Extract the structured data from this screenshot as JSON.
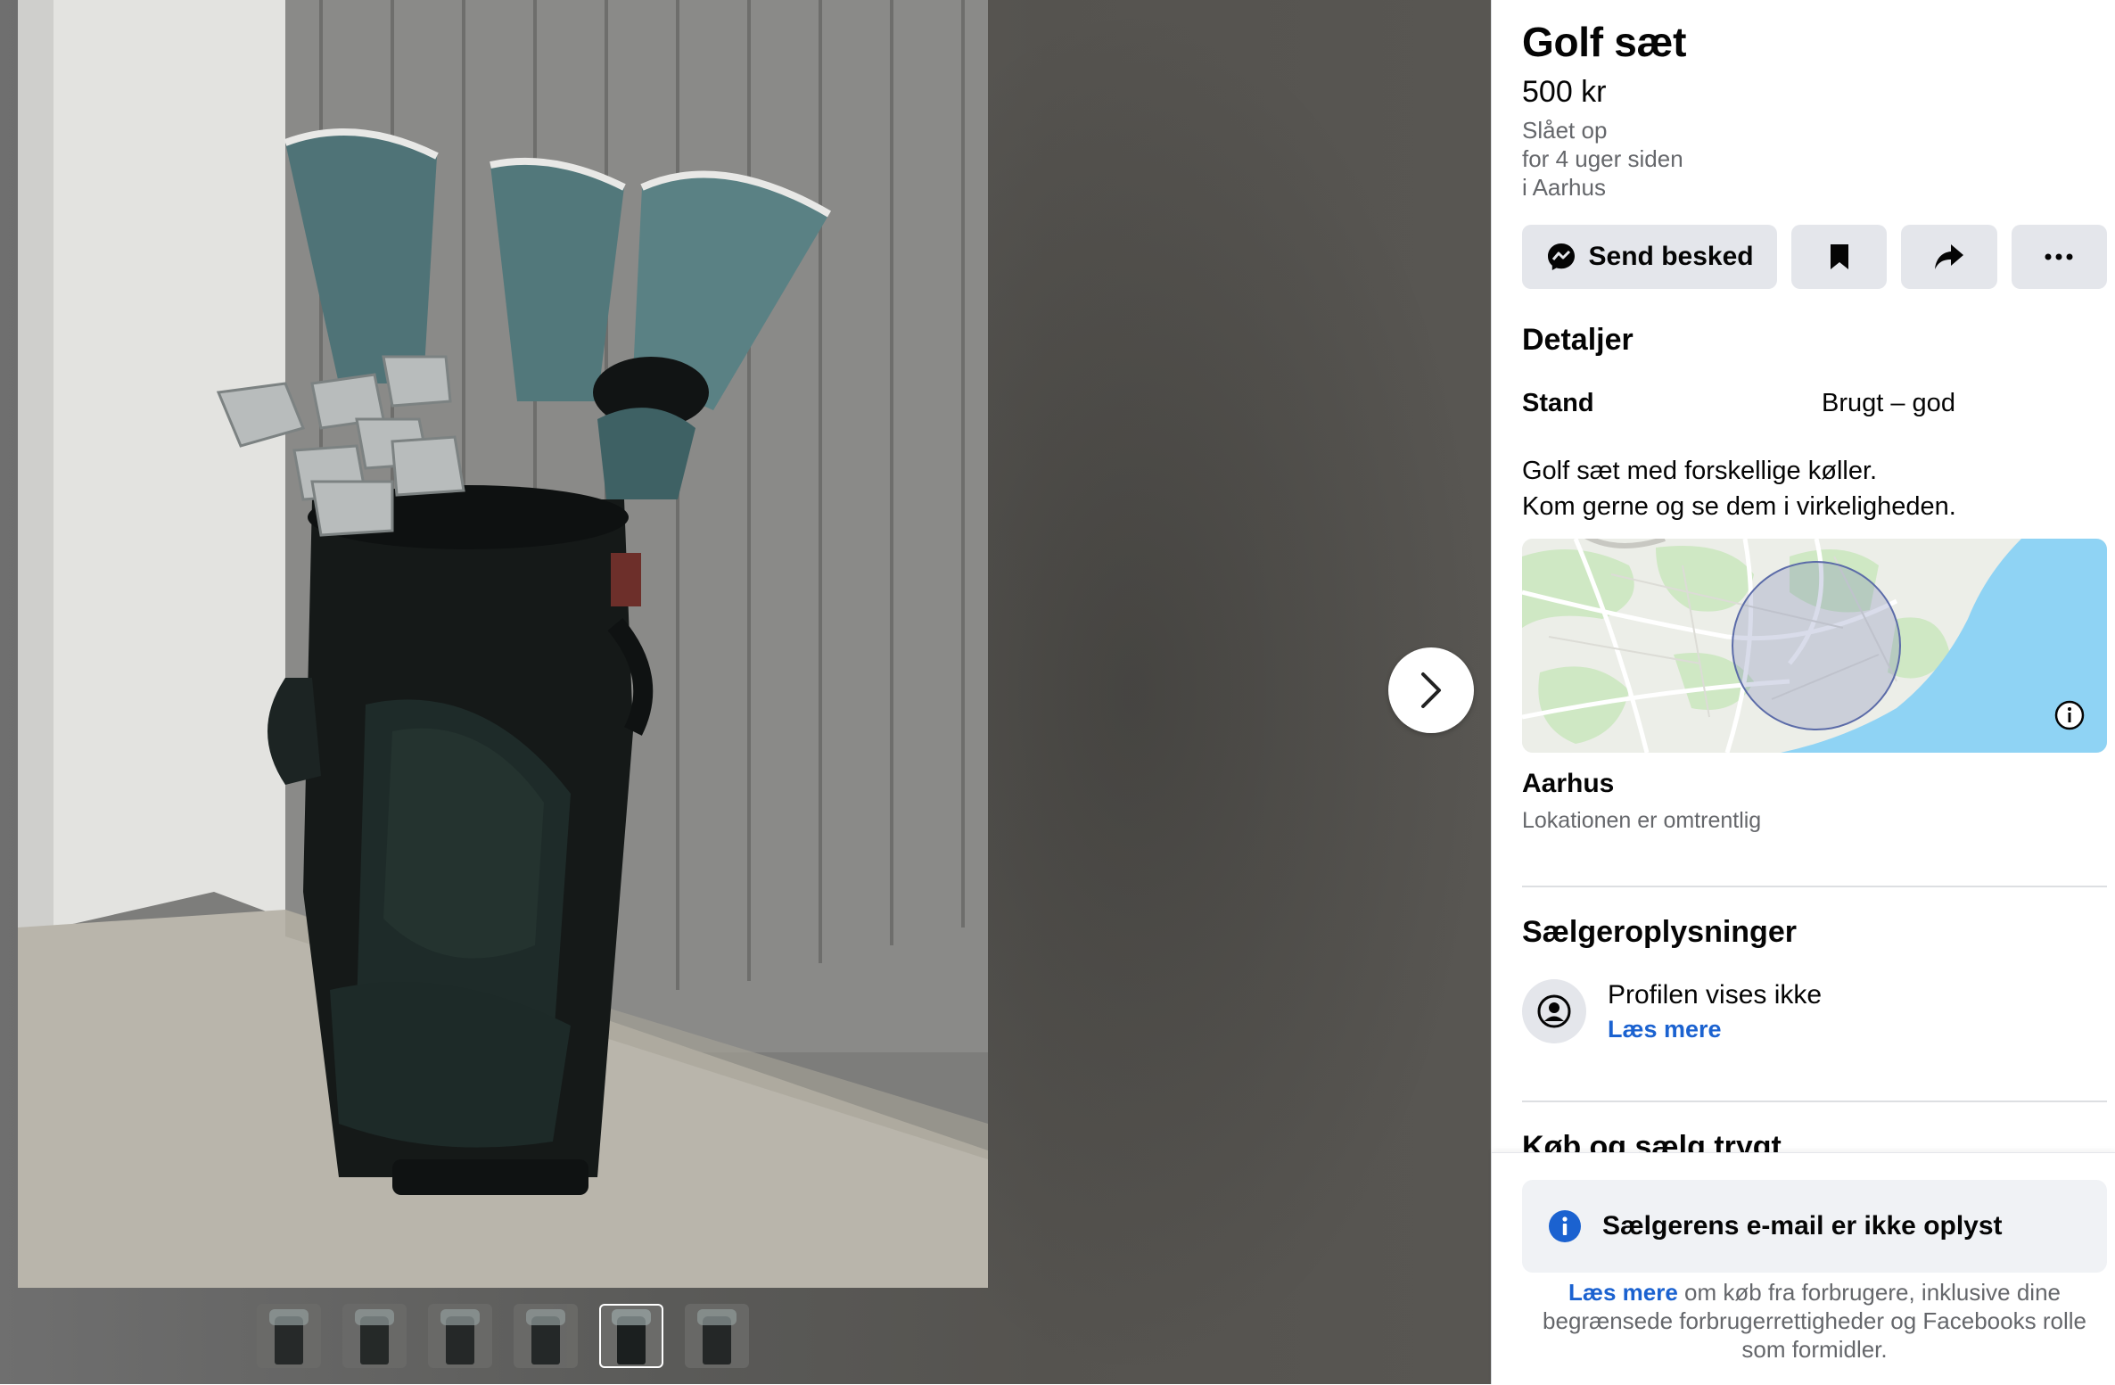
{
  "listing": {
    "title": "Golf sæt",
    "price": "500 kr",
    "posted_line1": "Slået op",
    "posted_line2": "for 4 uger siden",
    "posted_line3": "i Aarhus"
  },
  "actions": {
    "send_label": "Send besked",
    "icons": [
      "messenger-icon",
      "bookmark-icon",
      "share-icon",
      "more-icon"
    ]
  },
  "details": {
    "heading": "Detaljer",
    "stand_label": "Stand",
    "stand_value": "Brugt – god",
    "description_line1": "Golf sæt med forskellige køller.",
    "description_line2": "Kom gerne og se dem i virkeligheden."
  },
  "location": {
    "name": "Aarhus",
    "note": "Lokationen er omtrentlig"
  },
  "seller": {
    "heading": "Sælgeroplysninger",
    "profile_text": "Profilen vises ikke",
    "read_more": "Læs mere"
  },
  "trust": {
    "heading": "Køb og sælg trygt"
  },
  "notice": {
    "text": "Sælgerens e-mail er ikke oplyst",
    "read_more": "Læs mere",
    "footer": " om køb fra forbrugere, inklusive dine begrænsede forbrugerrettigheder og Facebooks rolle som formidler."
  },
  "gallery": {
    "thumbnail_count": 6,
    "active_thumbnail": 5
  },
  "colors": {
    "link": "#1b62d0",
    "button_bg": "#e4e6eb",
    "water": "#8fd3f4"
  }
}
